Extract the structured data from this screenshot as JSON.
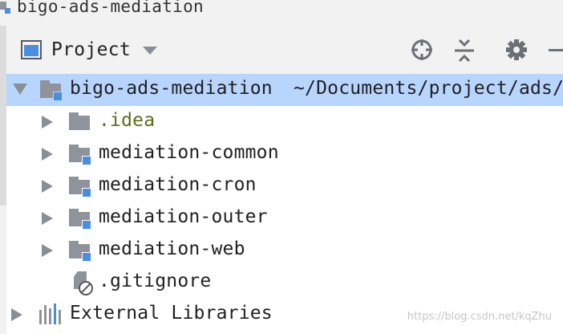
{
  "breadcrumb": {
    "module": "bigo-ads-mediation"
  },
  "panel": {
    "title": "Project",
    "tools": [
      "locate-icon",
      "collapse-all-icon",
      "gear-icon",
      "minimize-icon"
    ]
  },
  "tree": {
    "root": {
      "name": "bigo-ads-mediation",
      "path": "~/Documents/project/ads/"
    },
    "children": [
      {
        "name": ".idea",
        "kind": "folder"
      },
      {
        "name": "mediation-common",
        "kind": "module"
      },
      {
        "name": "mediation-cron",
        "kind": "module"
      },
      {
        "name": "mediation-outer",
        "kind": "module"
      },
      {
        "name": "mediation-web",
        "kind": "module"
      },
      {
        "name": ".gitignore",
        "kind": "ignored-file"
      }
    ],
    "external": {
      "name": "External Libraries"
    }
  },
  "colors": {
    "selection": "#b8d5ff",
    "module_badge": "#4a8ee0",
    "idea_text": "#5f6b1a"
  },
  "watermark": "https://blog.csdn.net/kqZhu"
}
